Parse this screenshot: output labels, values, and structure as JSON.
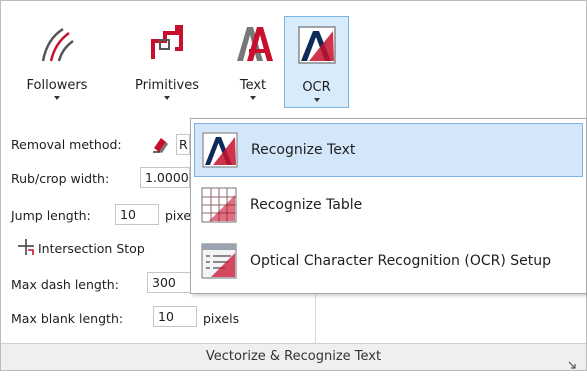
{
  "ribbon": {
    "buttons": [
      {
        "label": "Followers",
        "icon": "followers-icon"
      },
      {
        "label": "Primitives",
        "icon": "primitives-icon"
      },
      {
        "label": "Text",
        "icon": "text-icon"
      },
      {
        "label": "OCR",
        "icon": "ocr-icon"
      }
    ]
  },
  "settings": {
    "removal_method_label": "Removal method:",
    "removal_method_value": "R",
    "rub_crop_width_label": "Rub/crop width:",
    "rub_crop_width_value": "1.0000",
    "jump_length_label": "Jump length:",
    "jump_length_value": "10",
    "jump_length_unit": "pixe",
    "intersection_stop_label": "Intersection Stop",
    "max_dash_length_label": "Max dash length:",
    "max_dash_length_value": "300",
    "max_blank_length_label": "Max blank length:",
    "max_blank_length_value": "10",
    "max_blank_length_unit": "pixels"
  },
  "footer": {
    "title": "Vectorize & Recognize Text"
  },
  "ocr_menu": {
    "items": [
      {
        "label": "Recognize Text",
        "icon": "recognize-text-icon",
        "highlighted": true
      },
      {
        "label": "Recognize Table",
        "icon": "recognize-table-icon",
        "highlighted": false
      },
      {
        "label": "Optical Character Recognition (OCR) Setup",
        "icon": "ocr-setup-icon",
        "highlighted": false
      }
    ]
  },
  "colors": {
    "highlight_bg": "#d3e6fa",
    "highlight_border": "#7fb3e3",
    "accent_red": "#c8102e",
    "accent_navy": "#0e2a5a"
  }
}
